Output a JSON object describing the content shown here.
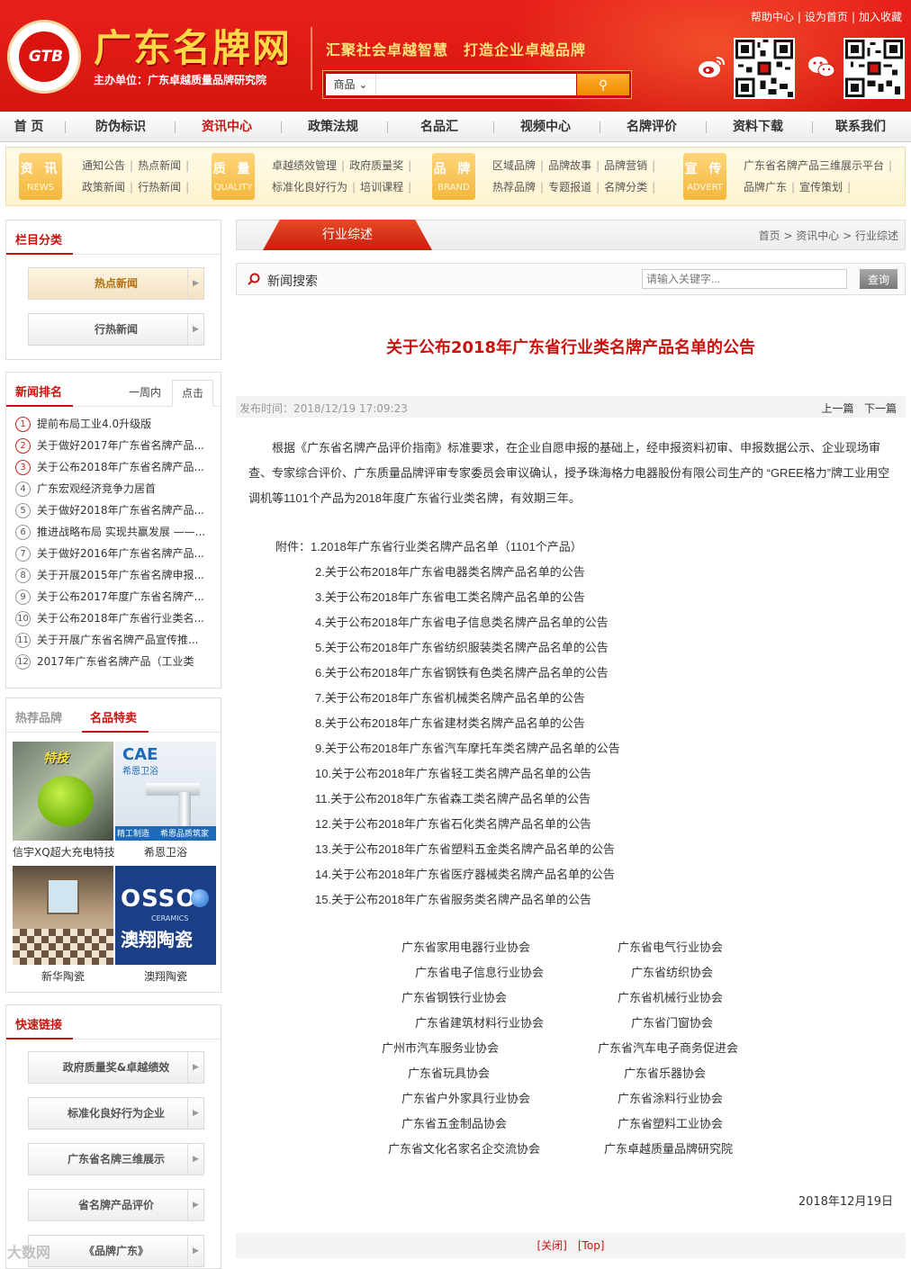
{
  "header": {
    "site_name": "广东名牌网",
    "logo_text": "GTB",
    "host_unit": "主办单位：广东卓越质量品牌研究院",
    "slogan": "汇聚社会卓越智慧　打造企业卓越品牌",
    "search_category": "商品",
    "search_placeholder": "",
    "top_links": [
      "帮助中心",
      "设为首页",
      "加入收藏"
    ],
    "brand_color": "#d61510",
    "accent_color": "#ffd84a"
  },
  "nav": [
    "首 页",
    "防伪标识",
    "资讯中心",
    "政策法规",
    "名品汇",
    "视频中心",
    "名牌评价",
    "资料下载",
    "联系我们"
  ],
  "nav_active": "资讯中心",
  "categories": [
    {
      "cn": "资 讯",
      "en": "NEWS",
      "row1": [
        "通知公告",
        "热点新闻"
      ],
      "row2": [
        "政策新闻",
        "行热新闻"
      ]
    },
    {
      "cn": "质 量",
      "en": "QUALITY",
      "row1": [
        "卓越绩效管理",
        "政府质量奖"
      ],
      "row2": [
        "标准化良好行为",
        "培训课程"
      ]
    },
    {
      "cn": "品 牌",
      "en": "BRAND",
      "row1": [
        "区域品牌",
        "品牌故事",
        "品牌营销"
      ],
      "row2": [
        "热荐品牌",
        "专题报道",
        "名牌分类"
      ]
    },
    {
      "cn": "宣 传",
      "en": "ADVERT",
      "row1": [
        "广东省名牌产品三维展示平台"
      ],
      "row2": [
        "品牌广东",
        "宣传策划"
      ]
    }
  ],
  "sidebar": {
    "column_title": "栏目分类",
    "column_buttons": [
      "热点新闻",
      "行热新闻"
    ],
    "rank_title": "新闻排名",
    "rank_tabs": [
      "一周内",
      "点击"
    ],
    "rank_items": [
      {
        "n": "1",
        "text": "提前布局工业4.0升级版"
      },
      {
        "n": "2",
        "text": "关于做好2017年广东省名牌产品..."
      },
      {
        "n": "3",
        "text": "关于公布2018年广东省名牌产品..."
      },
      {
        "n": "4",
        "text": "广东宏观经济竞争力居首"
      },
      {
        "n": "5",
        "text": "关于做好2018年广东省名牌产品..."
      },
      {
        "n": "6",
        "text": "推进战略布局 实现共赢发展 ——..."
      },
      {
        "n": "7",
        "text": "关于做好2016年广东省名牌产品..."
      },
      {
        "n": "8",
        "text": "关于开展2015年广东省名牌申报..."
      },
      {
        "n": "9",
        "text": "关于公布2017年度广东省名牌产..."
      },
      {
        "n": "10",
        "text": "关于公布2018年广东省行业类名..."
      },
      {
        "n": "11",
        "text": "关于开展广东省名牌产品宣传推..."
      },
      {
        "n": "12",
        "text": "2017年广东省名牌产品（工业类"
      }
    ],
    "brand_tabs": [
      "热荐品牌",
      "名品特卖"
    ],
    "products": [
      "信宇XQ超大充电特技",
      "希恩卫浴",
      "新华陶瓷",
      "澳翔陶瓷"
    ],
    "product_img_text": {
      "p1": "特技",
      "p2_logo": "CAE",
      "p2_sub": "希恩卫浴",
      "p2_tag1": "精工制造",
      "p2_tag2": "希恩品质筑家",
      "p4_logo": "OSSO",
      "p4_sub": "CERAMICS",
      "p4_cn": "澳翔陶瓷"
    },
    "quick_title": "快速链接",
    "quick_buttons": [
      "政府质量奖&卓越绩效",
      "标准化良好行为企业",
      "广东省名牌三维展示",
      "省名牌产品评价",
      "《品牌广东》"
    ]
  },
  "main": {
    "section_tab": "行业综述",
    "breadcrumb": "首页 > 资讯中心 > 行业综述",
    "search_label": "新闻搜索",
    "search_placeholder": "请输入关键字...",
    "search_button": "查询",
    "title": "关于公布2018年广东省行业类名牌产品名单的公告",
    "publish_time": "发布时间：2018/12/19 17:09:23",
    "prev": "上一篇",
    "next": "下一篇",
    "paragraph": "根据《广东省名牌产品评价指南》标准要求，在企业自愿申报的基础上，经申报资料初审、申报数据公示、企业现场审查、专家综合评价、广东质量品牌评审专家委员会审议确认，授予珠海格力电器股份有限公司生产的 “GREE格力”牌工业用空调机等1101个产品为2018年度广东省行业类名牌，有效期三年。",
    "attachment_label": "附件：",
    "attachments": [
      "1.2018年广东省行业类名牌产品名单（1101个产品）",
      "2.关于公布2018年广东省电器类名牌产品名单的公告",
      "3.关于公布2018年广东省电工类名牌产品名单的公告",
      "4.关于公布2018年广东省电子信息类名牌产品名单的公告",
      "5.关于公布2018年广东省纺织服装类名牌产品名单的公告",
      "6.关于公布2018年广东省钢铁有色类名牌产品名单的公告",
      "7.关于公布2018年广东省机械类名牌产品名单的公告",
      "8.关于公布2018年广东省建材类名牌产品名单的公告",
      "9.关于公布2018年广东省汽车摩托车类名牌产品名单的公告",
      "10.关于公布2018年广东省轻工类名牌产品名单的公告",
      "11.关于公布2018年广东省森工类名牌产品名单的公告",
      "12.关于公布2018年广东省石化类名牌产品名单的公告",
      "13.关于公布2018年广东省塑料五金类名牌产品名单的公告",
      "14.关于公布2018年广东省医疗器械类名牌产品名单的公告",
      "15.关于公布2018年广东省服务类名牌产品名单的公告"
    ],
    "orgs": [
      [
        "广东省家用电器行业协会",
        "广东省电气行业协会"
      ],
      [
        "广东省电子信息行业协会",
        "广东省纺织协会"
      ],
      [
        "广东省钢铁行业协会",
        "广东省机械行业协会"
      ],
      [
        "广东省建筑材料行业协会",
        "广东省门窗协会"
      ],
      [
        "广州市汽车服务业协会",
        "广东省汽车电子商务促进会"
      ],
      [
        "广东省玩具协会",
        "广东省乐器协会"
      ],
      [
        "广东省户外家具行业协会",
        "广东省涂料行业协会"
      ],
      [
        "广东省五金制品协会",
        "广东省塑料工业协会"
      ],
      [
        "广东省文化名家名企交流协会",
        "广东卓越质量品牌研究院"
      ]
    ],
    "date": "2018年12月19日",
    "bottom_links": [
      "[关闭]",
      "[Top]"
    ]
  },
  "watermark": "大数网"
}
